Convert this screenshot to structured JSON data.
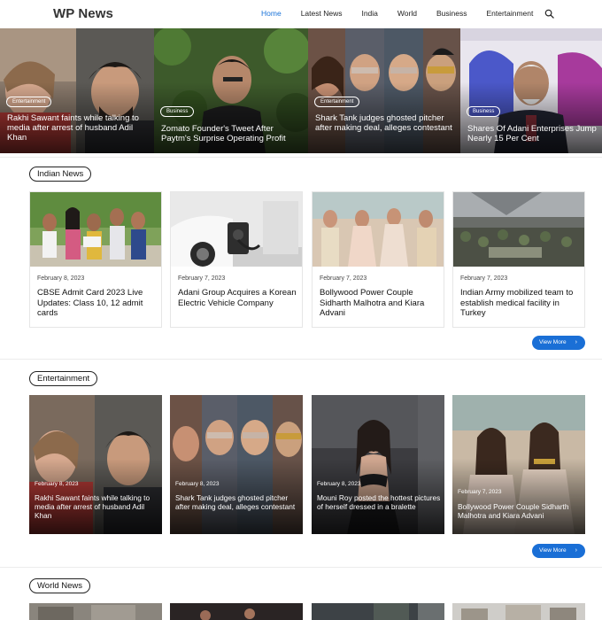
{
  "site": {
    "logo": "WP News",
    "nav": [
      "Home",
      "Latest News",
      "India",
      "World",
      "Business",
      "Entertainment"
    ],
    "active_nav": "Home",
    "search_icon": "search-icon"
  },
  "hero": [
    {
      "category": "Entertainment",
      "title": "Rakhi Sawant faints while talking to media after arrest of husband Adil Khan"
    },
    {
      "category": "Business",
      "title": "Zomato Founder's Tweet After Paytm's Surprise Operating Profit"
    },
    {
      "category": "Entertainment",
      "title": "Shark Tank judges ghosted pitcher after making deal, alleges contestant"
    },
    {
      "category": "Business",
      "title": "Shares Of Adani Enterprises Jump Nearly 15 Per Cent"
    }
  ],
  "indian_news": {
    "heading": "Indian News",
    "cards": [
      {
        "date": "February 8, 2023",
        "title": "CBSE Admit Card 2023 Live Updates: Class 10, 12 admit cards"
      },
      {
        "date": "February 7, 2023",
        "title": "Adani Group Acquires a Korean Electric Vehicle Company"
      },
      {
        "date": "February 7, 2023",
        "title": "Bollywood Power Couple Sidharth Malhotra and Kiara Advani"
      },
      {
        "date": "February 7, 2023",
        "title": "Indian Army mobilized team to establish medical facility in Turkey"
      }
    ],
    "view_more": "View More"
  },
  "entertainment": {
    "heading": "Entertainment",
    "tiles": [
      {
        "date": "February 8, 2023",
        "title": "Rakhi Sawant faints while talking to media after arrest of husband Adil Khan"
      },
      {
        "date": "February 8, 2023",
        "title": "Shark Tank judges ghosted pitcher after making deal, alleges contestant"
      },
      {
        "date": "February 8, 2023",
        "title": "Mouni Roy posted the hottest pictures of herself dressed in a bralette"
      },
      {
        "date": "February 7, 2023",
        "title": "Bollywood Power Couple Sidharth Malhotra and Kiara Advani"
      }
    ],
    "view_more": "View More"
  },
  "world_news": {
    "heading": "World News"
  },
  "colors": {
    "accent": "#1a73d9",
    "button": "#1a6fd6"
  }
}
